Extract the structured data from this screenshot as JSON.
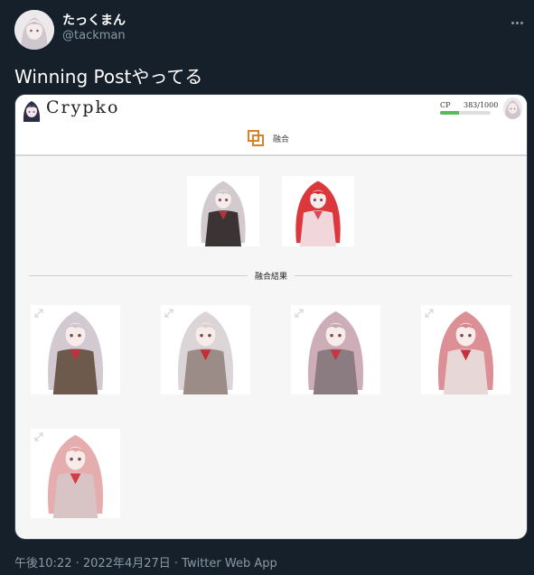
{
  "tweet": {
    "display_name": "たっくまん",
    "handle": "@tackman",
    "text": "Winning Postやってる",
    "footer": "午後10:22 · 2022年4月27日 · Twitter Web App"
  },
  "app": {
    "name": "Crypko",
    "cp_label": "CP",
    "cp_value": "383/1000",
    "cp_progress": 0.383,
    "nav_label": "融合",
    "result_label": "融合結果"
  },
  "parents": [
    {
      "hair": "#cfc6cc",
      "outfit": "#3a3434",
      "accent": "#b7323a"
    },
    {
      "hair": "#d8262b",
      "outfit": "#f1d7db",
      "accent": "#d44a58"
    }
  ],
  "results": [
    {
      "hair": "#cfc5cd",
      "outfit": "#6e5a4c",
      "accent": "#c2303a"
    },
    {
      "hair": "#d9d1d4",
      "outfit": "#9b8c87",
      "accent": "#c72c34"
    },
    {
      "hair": "#c9a6b1",
      "outfit": "#8a7c81",
      "accent": "#c83542"
    },
    {
      "hair": "#d9868b",
      "outfit": "#e7d7d6",
      "accent": "#c7323c"
    },
    {
      "hair": "#e3a6a6",
      "outfit": "#d8c4c4",
      "accent": "#d43945"
    }
  ]
}
